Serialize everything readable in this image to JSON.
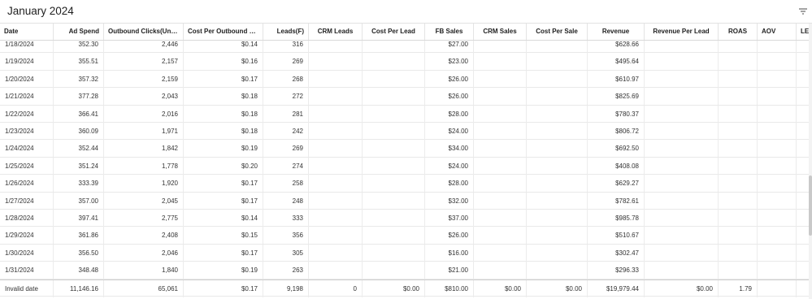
{
  "panel": {
    "title": "January 2024"
  },
  "icons": {
    "filter": "filter-icon"
  },
  "table": {
    "columns": [
      "Date",
      "Ad Spend",
      "Outbound Clicks(Unique)…",
      "Cost Per Outbound Click…",
      "Leads(F)",
      "CRM Leads",
      "Cost Per Lead",
      "FB Sales",
      "CRM Sales",
      "Cost Per Sale",
      "Revenue",
      "Revenue Per Lead",
      "ROAS",
      "AOV",
      "LEG"
    ],
    "rows": [
      [
        "1/18/2024",
        "352.30",
        "2,446",
        "$0.14",
        "316",
        "",
        "",
        "$27.00",
        "",
        "",
        "$628.66",
        "",
        "",
        "",
        ""
      ],
      [
        "1/19/2024",
        "355.51",
        "2,157",
        "$0.16",
        "269",
        "",
        "",
        "$23.00",
        "",
        "",
        "$495.64",
        "",
        "",
        "",
        ""
      ],
      [
        "1/20/2024",
        "357.32",
        "2,159",
        "$0.17",
        "268",
        "",
        "",
        "$26.00",
        "",
        "",
        "$610.97",
        "",
        "",
        "",
        ""
      ],
      [
        "1/21/2024",
        "377.28",
        "2,043",
        "$0.18",
        "272",
        "",
        "",
        "$26.00",
        "",
        "",
        "$825.69",
        "",
        "",
        "",
        ""
      ],
      [
        "1/22/2024",
        "366.41",
        "2,016",
        "$0.18",
        "281",
        "",
        "",
        "$28.00",
        "",
        "",
        "$780.37",
        "",
        "",
        "",
        ""
      ],
      [
        "1/23/2024",
        "360.09",
        "1,971",
        "$0.18",
        "242",
        "",
        "",
        "$24.00",
        "",
        "",
        "$806.72",
        "",
        "",
        "",
        ""
      ],
      [
        "1/24/2024",
        "352.44",
        "1,842",
        "$0.19",
        "269",
        "",
        "",
        "$34.00",
        "",
        "",
        "$692.50",
        "",
        "",
        "",
        ""
      ],
      [
        "1/25/2024",
        "351.24",
        "1,778",
        "$0.20",
        "274",
        "",
        "",
        "$24.00",
        "",
        "",
        "$408.08",
        "",
        "",
        "",
        ""
      ],
      [
        "1/26/2024",
        "333.39",
        "1,920",
        "$0.17",
        "258",
        "",
        "",
        "$28.00",
        "",
        "",
        "$629.27",
        "",
        "",
        "",
        ""
      ],
      [
        "1/27/2024",
        "357.00",
        "2,045",
        "$0.17",
        "248",
        "",
        "",
        "$32.00",
        "",
        "",
        "$782.61",
        "",
        "",
        "",
        ""
      ],
      [
        "1/28/2024",
        "397.41",
        "2,775",
        "$0.14",
        "333",
        "",
        "",
        "$37.00",
        "",
        "",
        "$985.78",
        "",
        "",
        "",
        ""
      ],
      [
        "1/29/2024",
        "361.86",
        "2,408",
        "$0.15",
        "356",
        "",
        "",
        "$26.00",
        "",
        "",
        "$510.67",
        "",
        "",
        "",
        ""
      ],
      [
        "1/30/2024",
        "356.50",
        "2,046",
        "$0.17",
        "305",
        "",
        "",
        "$16.00",
        "",
        "",
        "$302.47",
        "",
        "",
        "",
        ""
      ],
      [
        "1/31/2024",
        "348.48",
        "1,840",
        "$0.19",
        "263",
        "",
        "",
        "$21.00",
        "",
        "",
        "$296.33",
        "",
        "",
        "",
        ""
      ]
    ],
    "totals": [
      "Invalid date",
      "11,146.16",
      "65,061",
      "$0.17",
      "9,198",
      "0",
      "$0.00",
      "$810.00",
      "$0.00",
      "$0.00",
      "$19,979.44",
      "$0.00",
      "1.79",
      "",
      ""
    ]
  },
  "colors": {
    "header_border": "#d9d9d9",
    "row_border": "#e9e9e9",
    "scroll_thumb": "#c9c9c9"
  }
}
